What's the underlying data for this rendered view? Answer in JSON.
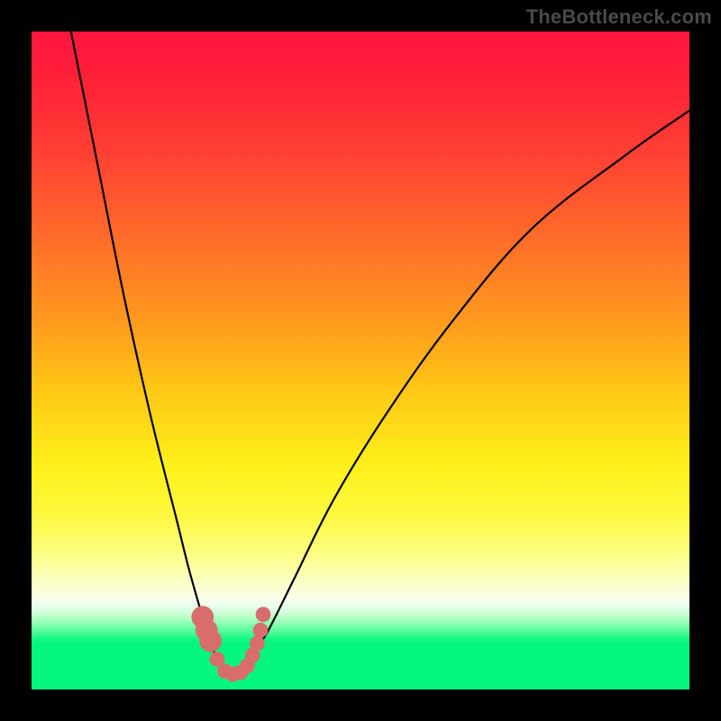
{
  "attribution": "TheBottleneck.com",
  "colors": {
    "frame": "#000000",
    "curve": "#000000",
    "marker": "#d96d6d",
    "gradient_stops": [
      "#ff163f",
      "#ff6e29",
      "#fef01a",
      "#fbffc3",
      "#05f67d"
    ]
  },
  "chart_data": {
    "type": "line",
    "title": "",
    "xlabel": "",
    "ylabel": "",
    "xlim": [
      0,
      100
    ],
    "ylim": [
      0,
      100
    ],
    "axes_visible": false,
    "grid": false,
    "optimum_x": 30,
    "series": [
      {
        "name": "bottleneck-curve",
        "x": [
          6,
          10,
          14,
          18,
          22,
          24,
          26,
          27,
          28,
          29,
          30,
          31,
          32,
          33,
          34,
          36,
          40,
          46,
          54,
          64,
          76,
          90,
          100
        ],
        "y": [
          100,
          80,
          60,
          42,
          26,
          18,
          11,
          8,
          5,
          3,
          2,
          2,
          3,
          4,
          6,
          9,
          17,
          29,
          42,
          56,
          70,
          81,
          88
        ]
      }
    ],
    "markers": {
      "name": "highlight-dots",
      "x": [
        26.0,
        26.6,
        27.2,
        28.2,
        29.4,
        30.6,
        31.8,
        32.8,
        33.6,
        34.3,
        34.8,
        35.2
      ],
      "y": [
        11.0,
        9.0,
        7.4,
        4.6,
        2.8,
        2.3,
        2.6,
        3.6,
        5.2,
        7.0,
        9.0,
        11.4
      ],
      "r_head": 1.7,
      "r_tail": 1.15
    }
  }
}
